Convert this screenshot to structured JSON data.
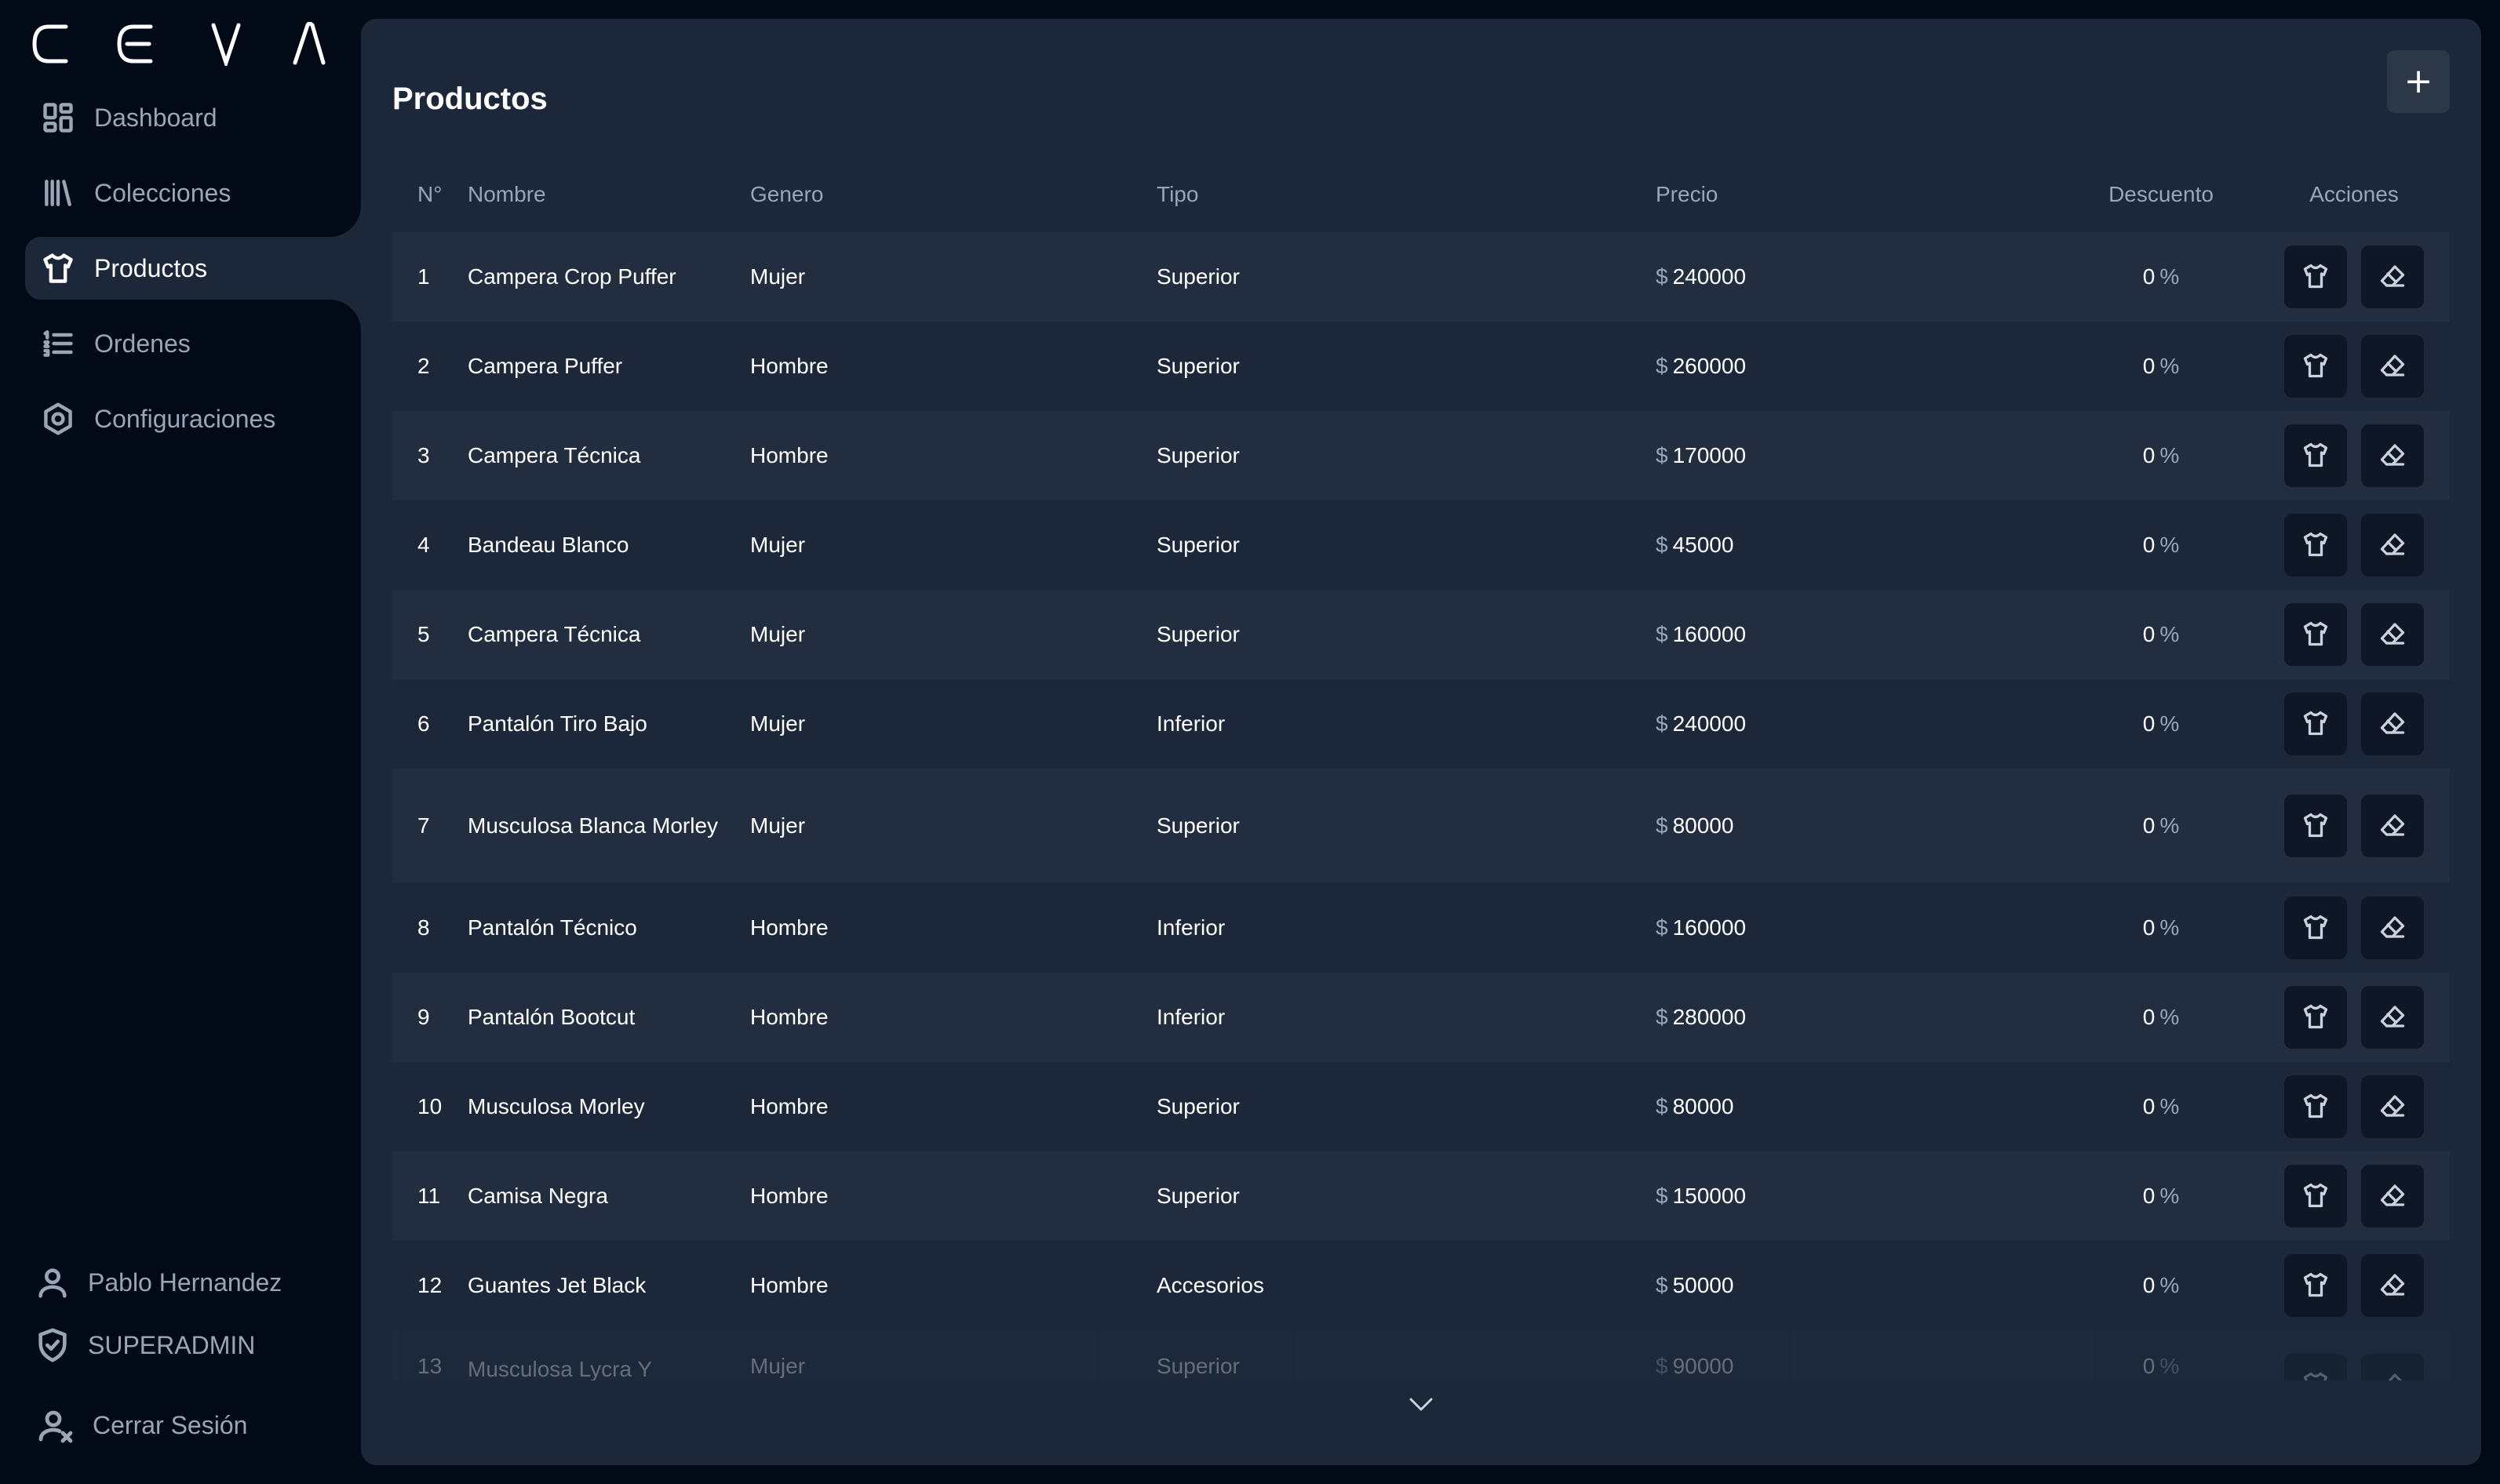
{
  "brand": {
    "logo_text": "CEVA"
  },
  "sidebar": {
    "items": [
      {
        "label": "Dashboard",
        "icon": "dashboard-icon"
      },
      {
        "label": "Colecciones",
        "icon": "library-icon"
      },
      {
        "label": "Productos",
        "icon": "shirt-icon",
        "active": true
      },
      {
        "label": "Ordenes",
        "icon": "ordered-list-icon"
      },
      {
        "label": "Configuraciones",
        "icon": "gear-icon"
      }
    ],
    "user_name": "Pablo Hernandez",
    "user_role": "SUPERADMIN",
    "logout_label": "Cerrar Sesión"
  },
  "main": {
    "title": "Productos",
    "add_label": "+",
    "columns": {
      "n": "N°",
      "name": "Nombre",
      "gender": "Genero",
      "type": "Tipo",
      "price": "Precio",
      "discount": "Descuento",
      "actions": "Acciones"
    },
    "currency_symbol": "$",
    "percent_symbol": "%",
    "rows": [
      {
        "n": "1",
        "name": "Campera Crop Puffer",
        "gender": "Mujer",
        "type": "Superior",
        "price": "240000",
        "discount": "0"
      },
      {
        "n": "2",
        "name": "Campera Puffer",
        "gender": "Hombre",
        "type": "Superior",
        "price": "260000",
        "discount": "0"
      },
      {
        "n": "3",
        "name": "Campera Técnica",
        "gender": "Hombre",
        "type": "Superior",
        "price": "170000",
        "discount": "0"
      },
      {
        "n": "4",
        "name": "Bandeau Blanco",
        "gender": "Mujer",
        "type": "Superior",
        "price": "45000",
        "discount": "0"
      },
      {
        "n": "5",
        "name": "Campera Técnica",
        "gender": "Mujer",
        "type": "Superior",
        "price": "160000",
        "discount": "0"
      },
      {
        "n": "6",
        "name": "Pantalón Tiro Bajo",
        "gender": "Mujer",
        "type": "Inferior",
        "price": "240000",
        "discount": "0"
      },
      {
        "n": "7",
        "name": "Musculosa Blanca Morley",
        "gender": "Mujer",
        "type": "Superior",
        "price": "80000",
        "discount": "0"
      },
      {
        "n": "8",
        "name": "Pantalón Técnico",
        "gender": "Hombre",
        "type": "Inferior",
        "price": "160000",
        "discount": "0"
      },
      {
        "n": "9",
        "name": "Pantalón Bootcut",
        "gender": "Hombre",
        "type": "Inferior",
        "price": "280000",
        "discount": "0"
      },
      {
        "n": "10",
        "name": "Musculosa Morley",
        "gender": "Hombre",
        "type": "Superior",
        "price": "80000",
        "discount": "0"
      },
      {
        "n": "11",
        "name": "Camisa Negra",
        "gender": "Hombre",
        "type": "Superior",
        "price": "150000",
        "discount": "0"
      },
      {
        "n": "12",
        "name": "Guantes Jet Black",
        "gender": "Hombre",
        "type": "Accesorios",
        "price": "50000",
        "discount": "0"
      },
      {
        "n": "13",
        "name": "Musculosa Lycra Y",
        "gender": "Mujer",
        "type": "Superior",
        "price": "90000",
        "discount": "0"
      }
    ]
  },
  "colors": {
    "background": "#030a17",
    "panel": "#1c283a",
    "row_alt": "#222e40",
    "button": "#0f1726",
    "muted_text": "#9aa6b6"
  }
}
